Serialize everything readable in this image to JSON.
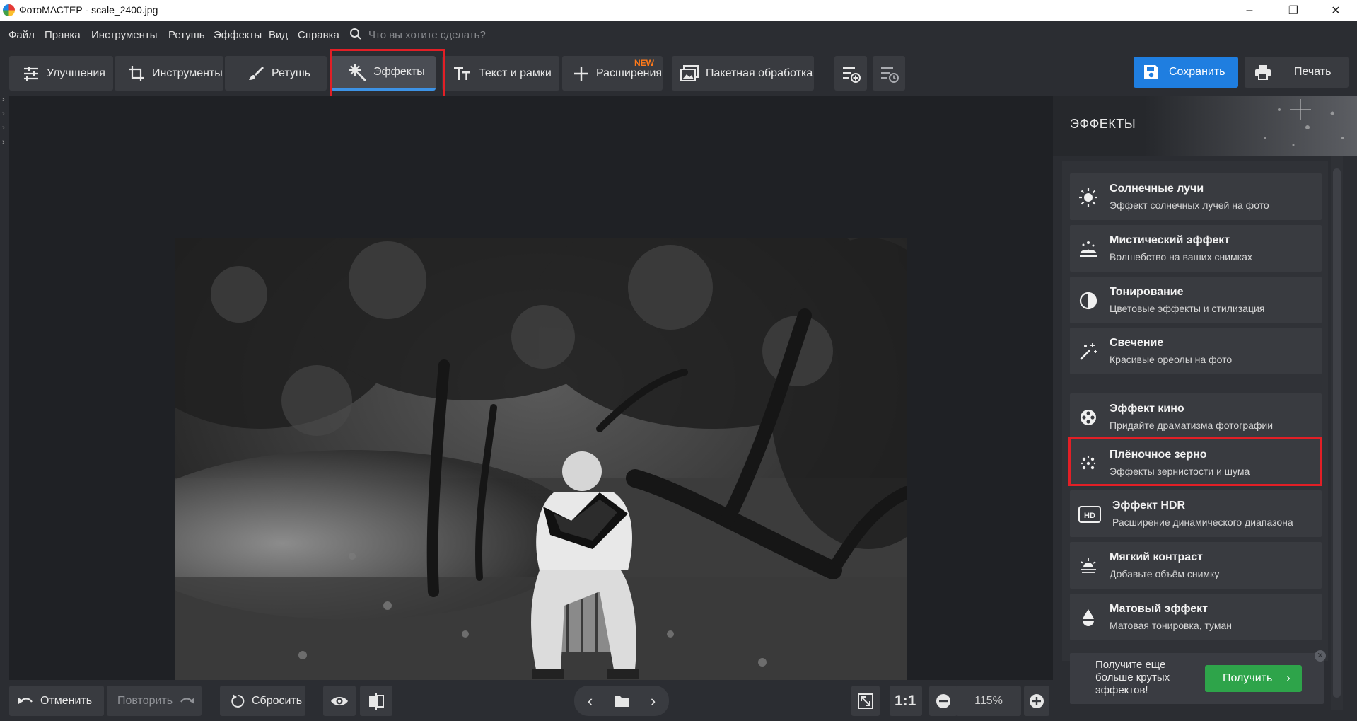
{
  "window": {
    "title": "ФотоМАСТЕР - scale_2400.jpg",
    "controls": [
      "–",
      "❐",
      "✕"
    ]
  },
  "menu": {
    "items": [
      "Файл",
      "Правка",
      "Инструменты",
      "Ретушь",
      "Эффекты",
      "Вид",
      "Справка"
    ],
    "search_placeholder": "Что вы хотите сделать?"
  },
  "toolbar": {
    "tabs": [
      "Улучшения",
      "Инструменты",
      "Ретушь",
      "Эффекты",
      "Текст и рамки",
      "Расширения",
      "Пакетная обработка"
    ],
    "active_tab": "Эффекты",
    "new_badge": "NEW",
    "save_label": "Сохранить",
    "print_label": "Печать"
  },
  "bottom": {
    "undo": "Отменить",
    "redo": "Повторить",
    "reset": "Сбросить",
    "fit_label": "1:1",
    "zoom": "115%"
  },
  "panel": {
    "title": "ЭФФЕКТЫ",
    "effects": [
      {
        "name": "Солнечные лучи",
        "desc": "Эффект солнечных лучей на фото",
        "icon": "sun-icon"
      },
      {
        "name": "Мистический эффект",
        "desc": "Волшебство на ваших снимках",
        "icon": "mystic-icon"
      },
      {
        "name": "Тонирование",
        "desc": "Цветовые эффекты и стилизация",
        "icon": "half-circle-icon"
      },
      {
        "name": "Свечение",
        "desc": "Красивые ореолы на фото",
        "icon": "magic-wand-icon"
      },
      {
        "name": "Эффект кино",
        "desc": "Придайте драматизма фотографии",
        "icon": "film-reel-icon"
      },
      {
        "name": "Плёночное зерно",
        "desc": "Эффекты зернистости и шума",
        "icon": "grain-icon"
      },
      {
        "name": "Эффект HDR",
        "desc": "Расширение динамического диапазона",
        "icon": "hdr-icon"
      },
      {
        "name": "Мягкий контраст",
        "desc": "Добавьте объём снимку",
        "icon": "soft-contrast-icon"
      },
      {
        "name": "Матовый эффект",
        "desc": "Матовая тонировка, туман",
        "icon": "drop-icon"
      }
    ],
    "promo_text": "Получите еще больше крутых эффектов!",
    "promo_button": "Получить"
  },
  "colors": {
    "accent": "#1f7ee0",
    "highlight": "#e21f26",
    "promo": "#2ea44a",
    "new_badge": "#ff7a1a"
  }
}
